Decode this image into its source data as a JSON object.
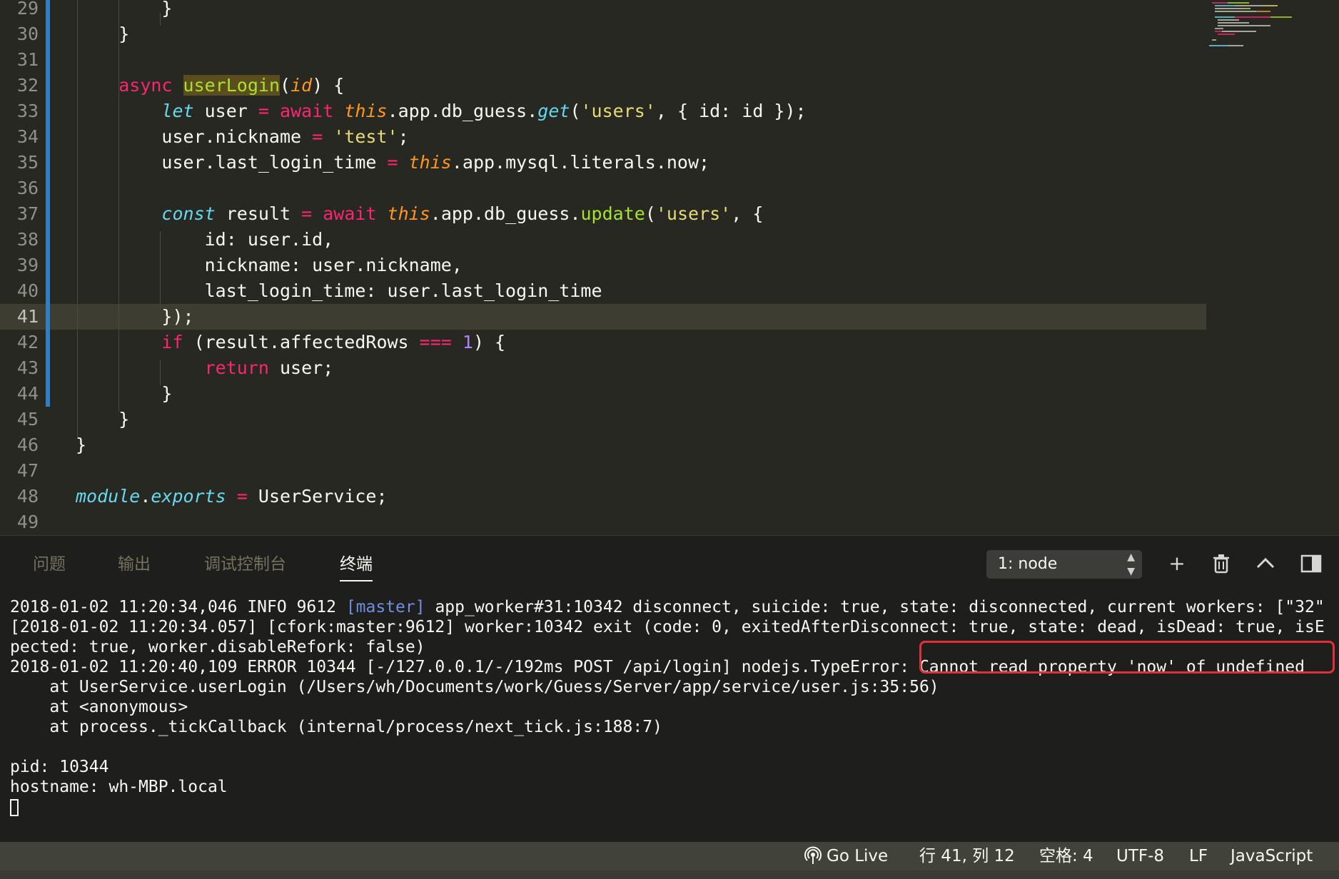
{
  "editor": {
    "current_line": 41,
    "lines": [
      {
        "n": "29",
        "tokens": [
          {
            "t": "        }"
          }
        ]
      },
      {
        "n": "30",
        "tokens": [
          {
            "t": "    }"
          }
        ]
      },
      {
        "n": "31",
        "tokens": [
          {
            "t": ""
          }
        ]
      },
      {
        "n": "32",
        "tokens": [
          {
            "t": "    "
          },
          {
            "t": "async",
            "c": "kw"
          },
          {
            "t": " "
          },
          {
            "t": "userLogin",
            "c": "fn sel-word"
          },
          {
            "t": "("
          },
          {
            "t": "id",
            "c": "par"
          },
          {
            "t": ") {"
          }
        ]
      },
      {
        "n": "33",
        "tokens": [
          {
            "t": "        "
          },
          {
            "t": "let",
            "c": "st"
          },
          {
            "t": " user "
          },
          {
            "t": "=",
            "c": "kw"
          },
          {
            "t": " "
          },
          {
            "t": "await",
            "c": "kw"
          },
          {
            "t": " "
          },
          {
            "t": "this",
            "c": "par"
          },
          {
            "t": ".app.db_guess."
          },
          {
            "t": "get",
            "c": "st"
          },
          {
            "t": "("
          },
          {
            "t": "'users'",
            "c": "str"
          },
          {
            "t": ", { id: id });"
          }
        ]
      },
      {
        "n": "34",
        "tokens": [
          {
            "t": "        user.nickname "
          },
          {
            "t": "=",
            "c": "kw"
          },
          {
            "t": " "
          },
          {
            "t": "'test'",
            "c": "str"
          },
          {
            "t": ";"
          }
        ]
      },
      {
        "n": "35",
        "tokens": [
          {
            "t": "        user.last_login_time "
          },
          {
            "t": "=",
            "c": "kw"
          },
          {
            "t": " "
          },
          {
            "t": "this",
            "c": "par"
          },
          {
            "t": ".app.mysql.literals.now;"
          }
        ]
      },
      {
        "n": "36",
        "tokens": [
          {
            "t": ""
          }
        ]
      },
      {
        "n": "37",
        "tokens": [
          {
            "t": "        "
          },
          {
            "t": "const",
            "c": "st"
          },
          {
            "t": " result "
          },
          {
            "t": "=",
            "c": "kw"
          },
          {
            "t": " "
          },
          {
            "t": "await",
            "c": "kw"
          },
          {
            "t": " "
          },
          {
            "t": "this",
            "c": "par"
          },
          {
            "t": ".app.db_guess."
          },
          {
            "t": "update",
            "c": "fn"
          },
          {
            "t": "("
          },
          {
            "t": "'users'",
            "c": "str"
          },
          {
            "t": ", {"
          }
        ]
      },
      {
        "n": "38",
        "tokens": [
          {
            "t": "            id: user.id,"
          }
        ]
      },
      {
        "n": "39",
        "tokens": [
          {
            "t": "            nickname: user.nickname,"
          }
        ]
      },
      {
        "n": "40",
        "tokens": [
          {
            "t": "            last_login_time: user.last_login_time"
          }
        ]
      },
      {
        "n": "41",
        "tokens": [
          {
            "t": "        });"
          }
        ]
      },
      {
        "n": "42",
        "tokens": [
          {
            "t": "        "
          },
          {
            "t": "if",
            "c": "kw"
          },
          {
            "t": " (result.affectedRows "
          },
          {
            "t": "===",
            "c": "kw"
          },
          {
            "t": " "
          },
          {
            "t": "1",
            "c": "num"
          },
          {
            "t": ") {"
          }
        ]
      },
      {
        "n": "43",
        "tokens": [
          {
            "t": "            "
          },
          {
            "t": "return",
            "c": "kw"
          },
          {
            "t": " user;"
          }
        ]
      },
      {
        "n": "44",
        "tokens": [
          {
            "t": "        }"
          }
        ]
      },
      {
        "n": "45",
        "tokens": [
          {
            "t": "    }"
          }
        ]
      },
      {
        "n": "46",
        "tokens": [
          {
            "t": "}"
          }
        ]
      },
      {
        "n": "47",
        "tokens": [
          {
            "t": ""
          }
        ]
      },
      {
        "n": "48",
        "tokens": [
          {
            "t": "module",
            "c": "st"
          },
          {
            "t": "."
          },
          {
            "t": "exports",
            "c": "st"
          },
          {
            "t": " "
          },
          {
            "t": "=",
            "c": "kw"
          },
          {
            "t": " UserService;"
          }
        ]
      },
      {
        "n": "49",
        "tokens": [
          {
            "t": ""
          }
        ]
      }
    ]
  },
  "panel": {
    "tabs": [
      {
        "label": "问题",
        "active": false
      },
      {
        "label": "输出",
        "active": false
      },
      {
        "label": "调试控制台",
        "active": false
      },
      {
        "label": "终端",
        "active": true
      }
    ],
    "terminal_select": "1: node",
    "buttons": {
      "add": "+",
      "trash": "🗑",
      "maximize": "^",
      "split": "◨"
    }
  },
  "terminal": {
    "lines": [
      [
        {
          "t": "2018-01-02 11:20:34,046 INFO 9612 "
        },
        {
          "t": "[master]",
          "c": "tag"
        },
        {
          "t": " app_worker#31:10342 disconnect, suicide: true, state: disconnected, current workers: [\"32\""
        }
      ],
      [
        {
          "t": "[2018-01-02 11:20:34.057] [cfork:master:9612] worker:10342 exit (code: 0, exitedAfterDisconnect: true, state: dead, isDead: true, isE"
        }
      ],
      [
        {
          "t": "pected: true, worker.disableRefork: false)"
        }
      ],
      [
        {
          "t": "2018-01-02 11:20:40,109 ERROR 10344 [-/127.0.0.1/-/192ms POST /api/login] nodejs.TypeError: Cannot read property 'now' of undefined"
        }
      ],
      [
        {
          "t": "    at UserService.userLogin (/Users/wh/Documents/work/Guess/Server/app/service/user.js:35:56)"
        }
      ],
      [
        {
          "t": "    at <anonymous>"
        }
      ],
      [
        {
          "t": "    at process._tickCallback (internal/process/next_tick.js:188:7)"
        }
      ],
      [
        {
          "t": ""
        }
      ],
      [
        {
          "t": "pid: 10344"
        }
      ],
      [
        {
          "t": "hostname: wh-MBP.local"
        }
      ],
      [
        {
          "t": ""
        }
      ]
    ]
  },
  "statusbar": {
    "go_live": "Go Live",
    "position": "行 41, 列 12",
    "indent": "空格: 4",
    "encoding": "UTF-8",
    "eol": "LF",
    "language": "JavaScript"
  },
  "theme": {
    "background": "#272822",
    "accent": "#2F7FC4",
    "error_box": "#E0303A"
  }
}
